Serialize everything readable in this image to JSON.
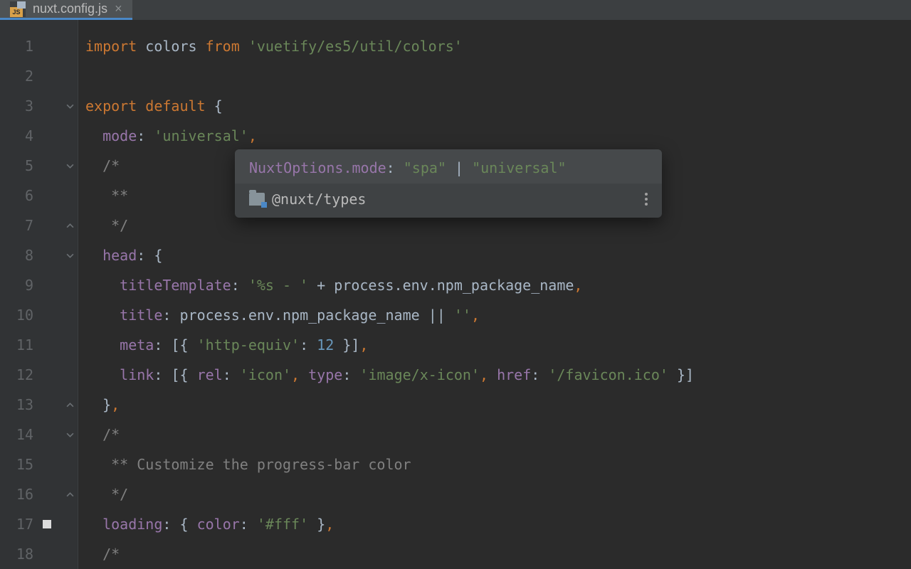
{
  "tab": {
    "filename": "nuxt.config.js",
    "fileicon_badge": "JS"
  },
  "gutter": {
    "lines": [
      "1",
      "2",
      "3",
      "4",
      "5",
      "6",
      "7",
      "8",
      "9",
      "10",
      "11",
      "12",
      "13",
      "14",
      "15",
      "16",
      "17",
      "18"
    ],
    "fold_down": [
      3,
      5,
      8,
      14
    ],
    "fold_up": [
      7,
      13,
      16
    ],
    "breakpoint": [
      17
    ]
  },
  "code": {
    "l1": {
      "kw1": "import",
      "id1": "colors",
      "kw2": "from",
      "str": "'vuetify/es5/util/colors'"
    },
    "l3": {
      "kw1": "export",
      "kw2": "default",
      "brace": "{"
    },
    "l4": {
      "prop": "mode",
      "colon": ":",
      "str": "'universal'",
      "comma": ","
    },
    "l5": {
      "comment": "/*"
    },
    "l6": {
      "comment": "**"
    },
    "l7": {
      "comment": "*/"
    },
    "l8": {
      "prop": "head",
      "colon": ":",
      "brace": "{"
    },
    "l9": {
      "prop": "titleTemplate",
      "colon": ":",
      "str": "'%s - '",
      "plus": "+",
      "id1": "process",
      "id2": "env",
      "id3": "npm_package_name",
      "comma": ","
    },
    "l10": {
      "prop": "title",
      "colon": ":",
      "id1": "process",
      "id2": "env",
      "id3": "npm_package_name",
      "or": "||",
      "str": "''",
      "comma": ","
    },
    "l11": {
      "prop": "meta",
      "colon": ":",
      "lb": "[{",
      "str": "'http-equiv'",
      "colon2": ":",
      "num": "12",
      "rb": "}]",
      "comma": ","
    },
    "l12": {
      "prop": "link",
      "colon": ":",
      "lb": "[{",
      "p1": "rel",
      "s1": "'icon'",
      "p2": "type",
      "s2": "'image/x-icon'",
      "p3": "href",
      "s3": "'/favicon.ico'",
      "rb": "}]"
    },
    "l13": {
      "brace": "}",
      "comma": ","
    },
    "l14": {
      "comment": "/*"
    },
    "l15": {
      "comment": "** Customize the progress-bar color"
    },
    "l16": {
      "comment": "*/"
    },
    "l17": {
      "prop": "loading",
      "colon": ":",
      "lb": "{",
      "p1": "color",
      "s1": "'#fff'",
      "rb": "}",
      "comma": ","
    },
    "l18": {
      "comment": "/*"
    }
  },
  "tooltip": {
    "type": "NuxtOptions.mode",
    "sep": ": ",
    "v1": "\"spa\"",
    "pipe": " | ",
    "v2": "\"universal\"",
    "package": "@nuxt/types"
  }
}
